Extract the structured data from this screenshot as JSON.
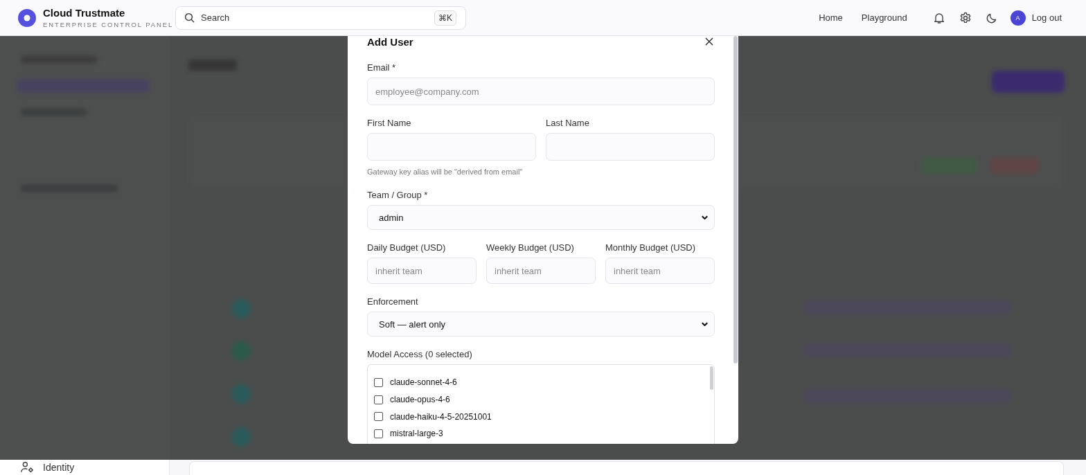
{
  "header": {
    "brand": {
      "name": "Cloud Trustmate",
      "tagline": "ENTERPRISE CONTROL PANEL"
    },
    "search": {
      "placeholder": "Search",
      "shortcut": "⌘K"
    },
    "nav": [
      {
        "label": "Home"
      },
      {
        "label": "Playground"
      }
    ],
    "avatar_initial": "A",
    "logout": "Log out"
  },
  "sidebar": {
    "items": [
      {
        "label": "Identity"
      }
    ]
  },
  "dialog": {
    "title": "Add User",
    "email": {
      "label": "Email *",
      "placeholder": "employee@company.com"
    },
    "name_fields": [
      {
        "label": "First Name"
      },
      {
        "label": "Last Name"
      }
    ],
    "hint": "Gateway key alias will be \"derived from email\"",
    "team": {
      "label": "Team / Group *",
      "value": "admin"
    },
    "budgets": [
      {
        "label": "Daily Budget (USD)",
        "placeholder": "inherit team"
      },
      {
        "label": "Weekly Budget (USD)",
        "placeholder": "inherit team"
      },
      {
        "label": "Monthly Budget (USD)",
        "placeholder": "inherit team"
      }
    ],
    "enforcement": {
      "label": "Enforcement",
      "value": "Soft — alert only"
    },
    "model_access": {
      "label": "Model Access (0 selected)",
      "models": [
        {
          "name": "claude-sonnet-4-6",
          "checked": false
        },
        {
          "name": "claude-opus-4-6",
          "checked": false
        },
        {
          "name": "claude-haiku-4-5-20251001",
          "checked": false
        },
        {
          "name": "mistral-large-3",
          "checked": false
        }
      ]
    }
  }
}
